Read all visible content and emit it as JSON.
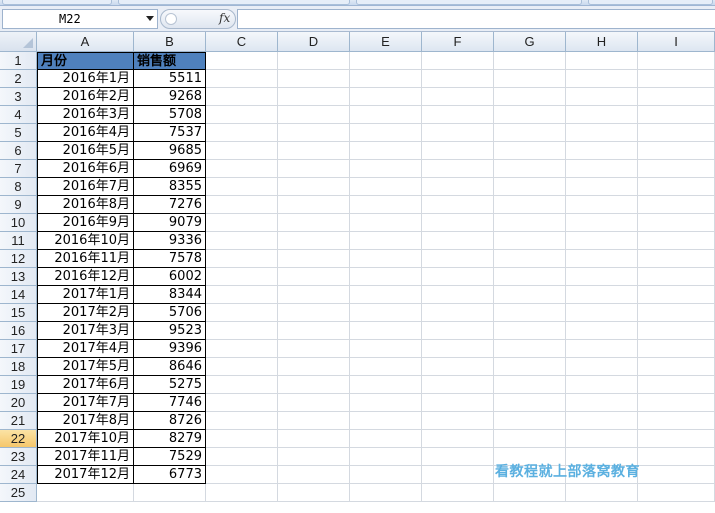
{
  "name_box": {
    "value": "M22"
  },
  "formula_bar": {
    "fx_label": "fx",
    "content": ""
  },
  "columns": [
    "A",
    "B",
    "C",
    "D",
    "E",
    "F",
    "G",
    "H",
    "I"
  ],
  "rows": [
    "1",
    "2",
    "3",
    "4",
    "5",
    "6",
    "7",
    "8",
    "9",
    "10",
    "11",
    "12",
    "13",
    "14",
    "15",
    "16",
    "17",
    "18",
    "19",
    "20",
    "21",
    "22",
    "23",
    "24",
    "25"
  ],
  "active_row": "22",
  "table": {
    "headers": [
      "月份",
      "销售额"
    ],
    "records": [
      [
        "2016年1月",
        "5511"
      ],
      [
        "2016年2月",
        "9268"
      ],
      [
        "2016年3月",
        "5708"
      ],
      [
        "2016年4月",
        "7537"
      ],
      [
        "2016年5月",
        "9685"
      ],
      [
        "2016年6月",
        "6969"
      ],
      [
        "2016年7月",
        "8355"
      ],
      [
        "2016年8月",
        "7276"
      ],
      [
        "2016年9月",
        "9079"
      ],
      [
        "2016年10月",
        "9336"
      ],
      [
        "2016年11月",
        "7578"
      ],
      [
        "2016年12月",
        "6002"
      ],
      [
        "2017年1月",
        "8344"
      ],
      [
        "2017年2月",
        "5706"
      ],
      [
        "2017年3月",
        "9523"
      ],
      [
        "2017年4月",
        "9396"
      ],
      [
        "2017年5月",
        "8646"
      ],
      [
        "2017年6月",
        "5275"
      ],
      [
        "2017年7月",
        "7746"
      ],
      [
        "2017年8月",
        "8726"
      ],
      [
        "2017年10月",
        "8279"
      ],
      [
        "2017年11月",
        "7529"
      ],
      [
        "2017年12月",
        "6773"
      ]
    ]
  },
  "watermark": "看教程就上部落窝教育",
  "colors": {
    "header_fill": "#4f81bd",
    "active_row_header": "#f6c76b",
    "watermark": "#5bb0e0"
  }
}
